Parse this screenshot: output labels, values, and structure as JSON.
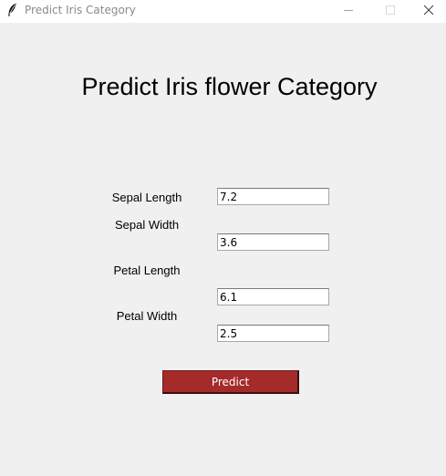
{
  "window": {
    "title": "Predict Iris Category",
    "app_icon": "feather-icon",
    "controls": {
      "minimize_icon": "minimize-icon",
      "maximize_icon": "maximize-icon",
      "close_icon": "close-icon"
    }
  },
  "main": {
    "heading": "Predict Iris flower Category",
    "fields": [
      {
        "label": "Sepal Length",
        "value": "7.2"
      },
      {
        "label": "Sepal Width",
        "value": "3.6"
      },
      {
        "label": "Petal Length",
        "value": "6.1"
      },
      {
        "label": "Petal Width",
        "value": "2.5"
      }
    ],
    "predict_button": {
      "label": "Predict",
      "color": "#a52a2a",
      "text_color": "#ffffff"
    }
  }
}
